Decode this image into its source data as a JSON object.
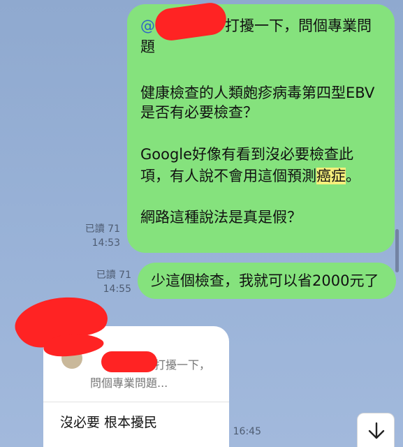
{
  "messages": [
    {
      "lines": [
        "打擾一下，問個專業問",
        "題",
        "健康檢查的人類皰疹病毒第四型EBV",
        "是否有必要檢查？",
        "Google好像有看到沒必要檢查此",
        "項，有人說不會用這個預測",
        "癌症",
        "。",
        "網路這種說法是真是假？"
      ],
      "mention_prefix": "@",
      "read": "已讀 71",
      "time": "14:53"
    },
    {
      "text": "少這個檢查，我就可以省2000元了",
      "read": "已讀 71",
      "time": "14:55"
    }
  ],
  "reply": {
    "quote_title": "打擾一下，",
    "quote_body": "問個專業問題...",
    "text": "沒必要  根本擾民",
    "time": "16:45"
  },
  "colors": {
    "background": "#9ab3d8",
    "outgoing_bubble": "#85e27d",
    "incoming_bubble": "#ffffff",
    "highlight": "#f6ef7c",
    "redaction": "#ff2323"
  },
  "icons": {
    "scroll_down": "arrow-down-icon"
  }
}
